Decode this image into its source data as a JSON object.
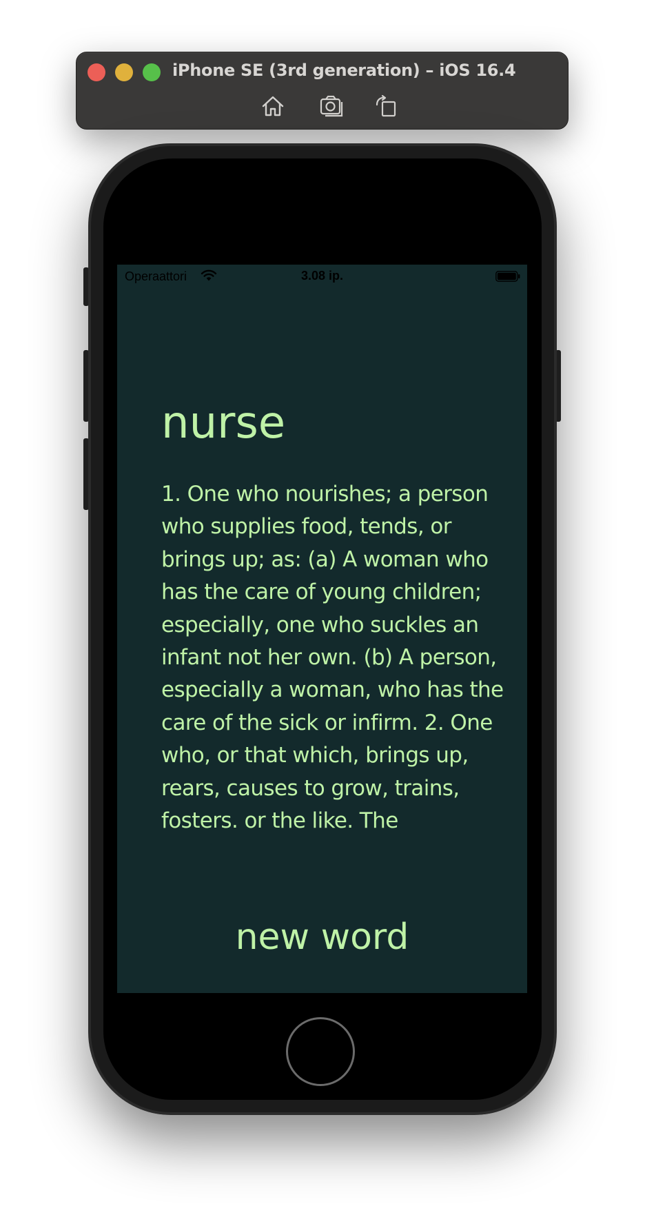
{
  "simulator": {
    "title": "iPhone SE (3rd generation) – iOS 16.4",
    "toolbar": [
      "home-icon",
      "screenshot-icon",
      "rotate-icon"
    ]
  },
  "status_bar": {
    "carrier": "Operaattori",
    "time": "3.08 ip."
  },
  "content": {
    "word": "nurse",
    "definition": "1. One who nourishes; a person who supplies food, tends, or brings up; as: (a) A woman who has the care of young children; especially, one who suckles an infant not her own. (b) A person, especially a woman, who has the care of the sick or infirm. 2. One who, or that which, brings up, rears, causes to grow, trains, fosters. or the like. The",
    "button_label": "new word"
  },
  "colors": {
    "background": "#132a2c",
    "text": "#bff2a7"
  }
}
